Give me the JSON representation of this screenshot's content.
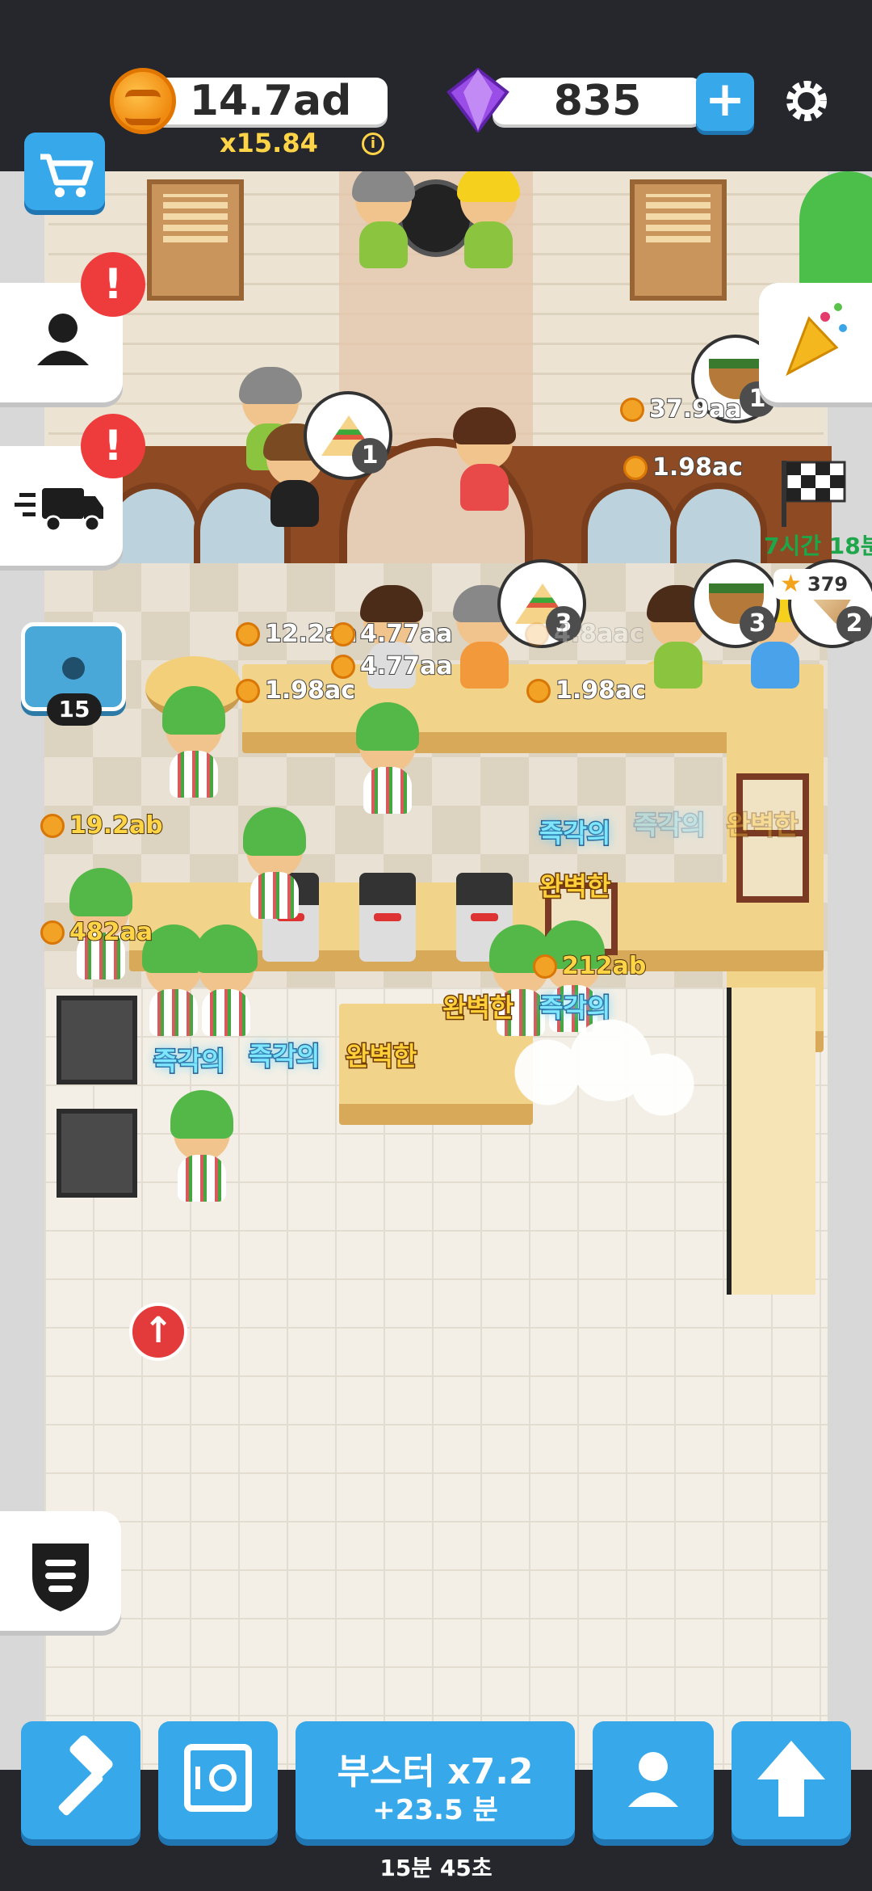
{
  "hud": {
    "coins": "14.7ad",
    "multiplier": "x15.84",
    "info_icon": "i",
    "gems": "835",
    "add_gems": "+"
  },
  "left_panel": {
    "chest_count": "15",
    "alert_mark": "!"
  },
  "right_panel": {
    "event_timer": "7시간 18분",
    "star_count": "379"
  },
  "orders": [
    {
      "food": "sandwich",
      "qty": "1"
    },
    {
      "food": "bowl",
      "qty": "1"
    },
    {
      "food": "sandwich",
      "qty": "3"
    },
    {
      "food": "bowl",
      "qty": "3"
    },
    {
      "food": "cone",
      "qty": "2"
    }
  ],
  "coin_labels": {
    "table_right_top": "37.9aa",
    "table_right_bottom": "1.98ac",
    "counter_a": "12.2aa",
    "counter_b": "4.77aa",
    "counter_c": "4.77aa",
    "counter_d": "1.98ac",
    "counter_e": "1.98ac",
    "counter_faded": "4.8aac",
    "left_upper": "19.2ab",
    "left_lower": "482aa",
    "kitchen": "212ab"
  },
  "floating_words": {
    "instant": "즉각의",
    "perfect": "완벽한"
  },
  "bottom_nav": {
    "booster_label": "부스터 x7.2",
    "booster_bonus": "+23.5 분",
    "booster_timer": "15분 45초"
  },
  "colors": {
    "accent_blue": "#37a9ea",
    "alert_red": "#ee3b3b",
    "coin_gold": "#f2a224",
    "chef_green": "#53b847"
  }
}
